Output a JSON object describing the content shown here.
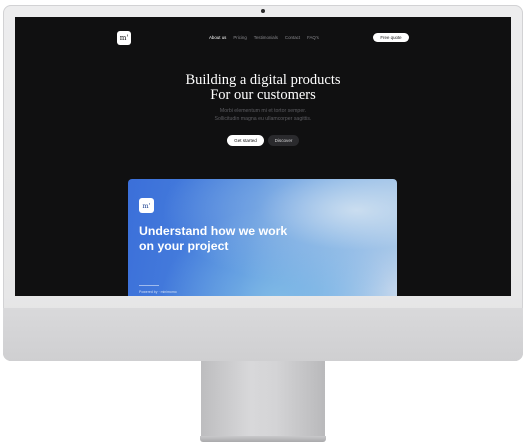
{
  "site": {
    "logo_text": "m'",
    "nav": [
      "About us",
      "Pricing",
      "Testimonials",
      "Contact",
      "FAQ's"
    ],
    "cta": "Free quote"
  },
  "hero": {
    "title_line1": "Building a digital products",
    "title_line2": "For our customers",
    "subtitle_line1": "Morbi elementum mi et tortor semper.",
    "subtitle_line2": "Sollicitudin magna eu ullamcorper sagittis.",
    "primary_button": "Get started",
    "secondary_button": "Discover"
  },
  "card": {
    "logo_text": "m'",
    "title_line1": "Understand how we work",
    "title_line2": "on your project",
    "footer": "Powered by · minimomo"
  },
  "colors": {
    "screen_bg": "#101011",
    "card_accent": "#3b6fd9"
  }
}
